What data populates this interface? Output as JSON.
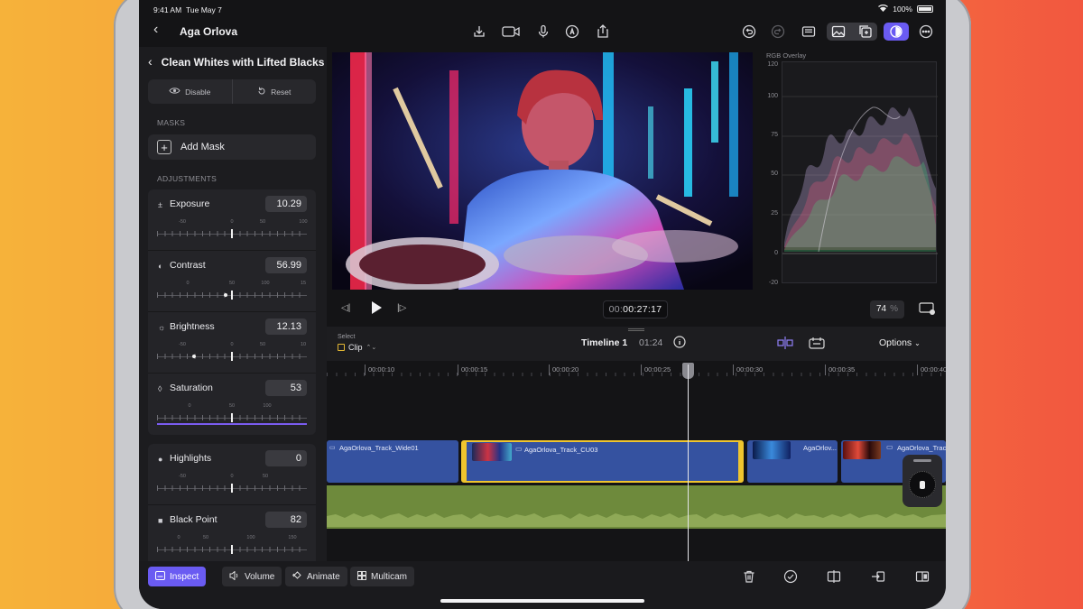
{
  "status": {
    "time": "9:41 AM",
    "date": "Tue May 7",
    "battery": "100%"
  },
  "topbar": {
    "project_title": "Aga Orlova",
    "icons": [
      "import-icon",
      "camera-icon",
      "microphone-icon",
      "pen-icon",
      "share-icon",
      "undo-icon",
      "redo-icon",
      "viewer-layout-icon",
      "photo-library-icon",
      "add-media-icon",
      "color-effect-icon",
      "more-icon"
    ]
  },
  "inspector": {
    "title": "Clean Whites with Lifted Blacks",
    "disable_label": "Disable",
    "reset_label": "Reset",
    "masks_header": "MASKS",
    "add_mask_label": "Add Mask",
    "adjustments_header": "ADJUSTMENTS",
    "adjustments": [
      {
        "name": "Exposure",
        "icon": "±",
        "value": "10.29",
        "scale": [
          "-50",
          "0",
          "50",
          "100"
        ]
      },
      {
        "name": "Contrast",
        "icon": "◐",
        "value": "56.99",
        "scale": [
          "0",
          "50",
          "100",
          "15"
        ]
      },
      {
        "name": "Brightness",
        "icon": "☼",
        "value": "12.13",
        "scale": [
          "-50",
          "0",
          "50",
          "10"
        ]
      },
      {
        "name": "Saturation",
        "icon": "◊",
        "value": "53",
        "scale": [
          "0",
          "50",
          "100"
        ]
      }
    ],
    "adjustments2": [
      {
        "name": "Highlights",
        "icon": "●",
        "value": "0",
        "scale": [
          "-50",
          "0",
          "50"
        ]
      },
      {
        "name": "Black Point",
        "icon": "■",
        "value": "82",
        "scale": [
          "0",
          "50",
          "100",
          "150"
        ]
      }
    ]
  },
  "scope": {
    "title": "RGB Overlay",
    "labels": [
      "120",
      "100",
      "75",
      "50",
      "25",
      "0",
      "-20"
    ]
  },
  "transport": {
    "timecode_dim": "00:",
    "timecode": "00:27:17",
    "zoom": "74",
    "zoom_unit": "%"
  },
  "timeline": {
    "select_label": "Select",
    "clip_label": "Clip",
    "name": "Timeline 1",
    "duration": "01:24",
    "options_label": "Options",
    "ruler": [
      "00:00:10",
      "00:00:15",
      "00:00:20",
      "00:00:25",
      "00:00:30",
      "00:00:35",
      "00:00:40"
    ],
    "clips": [
      "AgaOrlova_Track_Wide01",
      "AgaOrlova_Track_CU03",
      "AgaOrlov...",
      "AgaOrlova_Trac"
    ]
  },
  "bottombar": {
    "inspect_label": "Inspect",
    "volume_label": "Volume",
    "animate_label": "Animate",
    "multicam_label": "Multicam"
  }
}
